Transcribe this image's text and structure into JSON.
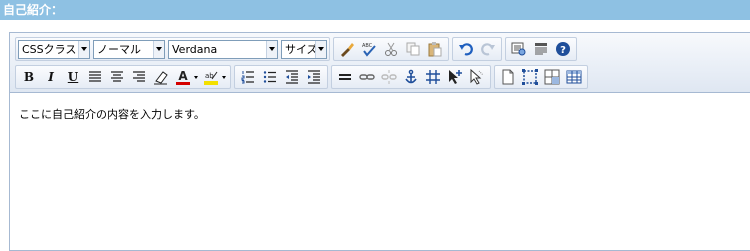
{
  "section": {
    "title": "自己紹介："
  },
  "toolbar": {
    "css_class": {
      "value": "CSSクラス"
    },
    "format": {
      "value": "ノーマル"
    },
    "font_name": {
      "value": "Verdana"
    },
    "font_size": {
      "value": "サイズ"
    },
    "buttons": {
      "bold": "B",
      "italic": "I",
      "underline": "U"
    },
    "colors": {
      "font_color": "#d40000",
      "highlight": "#f3e000",
      "accent": "#1f4e9a"
    }
  },
  "editor": {
    "content_text": "ここに自己紹介の内容を入力します。"
  }
}
